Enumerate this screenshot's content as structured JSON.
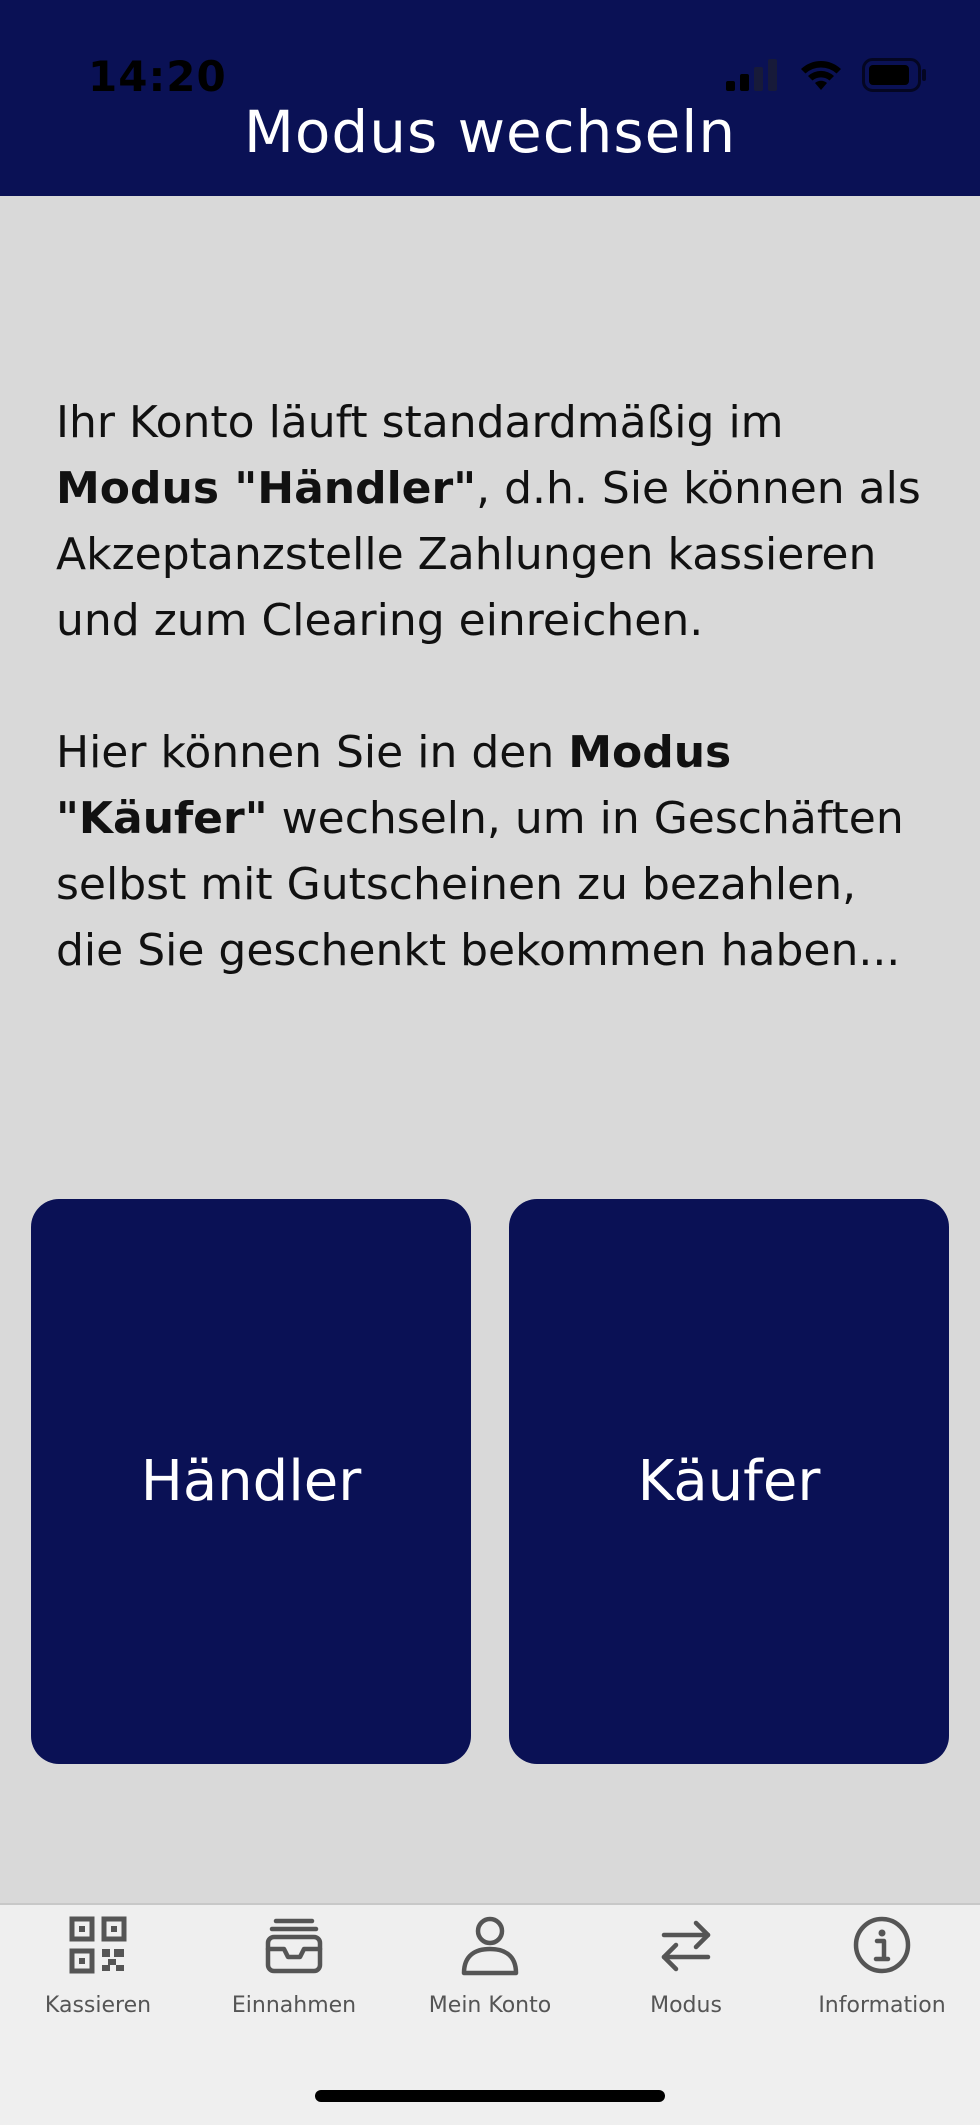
{
  "status_bar": {
    "time": "14:20"
  },
  "header": {
    "title": "Modus wechseln"
  },
  "content": {
    "paragraph1": {
      "before": "Ihr Konto läuft standardmäßig im ",
      "bold": "Modus \"Händler\"",
      "after": ", d.h. Sie können als Akzeptanzstelle Zahlungen kassieren und zum Clearing einreichen."
    },
    "paragraph2": {
      "before": "Hier können Sie in den ",
      "bold": "Modus \"Käufer\"",
      "after": " wechseln, um in Geschäften selbst mit Gutscheinen zu bezahlen, die Sie geschenkt bekommen haben..."
    }
  },
  "modes": {
    "haendler_label": "Händler",
    "kaeufer_label": "Käufer"
  },
  "tabbar": {
    "items": [
      {
        "label": "Kassieren",
        "icon": "qr-code-icon"
      },
      {
        "label": "Einnahmen",
        "icon": "inbox-icon"
      },
      {
        "label": "Mein Konto",
        "icon": "user-icon"
      },
      {
        "label": "Modus",
        "icon": "swap-arrows-icon"
      },
      {
        "label": "Information",
        "icon": "info-icon"
      }
    ]
  },
  "colors": {
    "primary": "#0a1155",
    "background": "#d9d9d9",
    "tabbar_background": "#efefef",
    "tab_icon": "#555555"
  }
}
